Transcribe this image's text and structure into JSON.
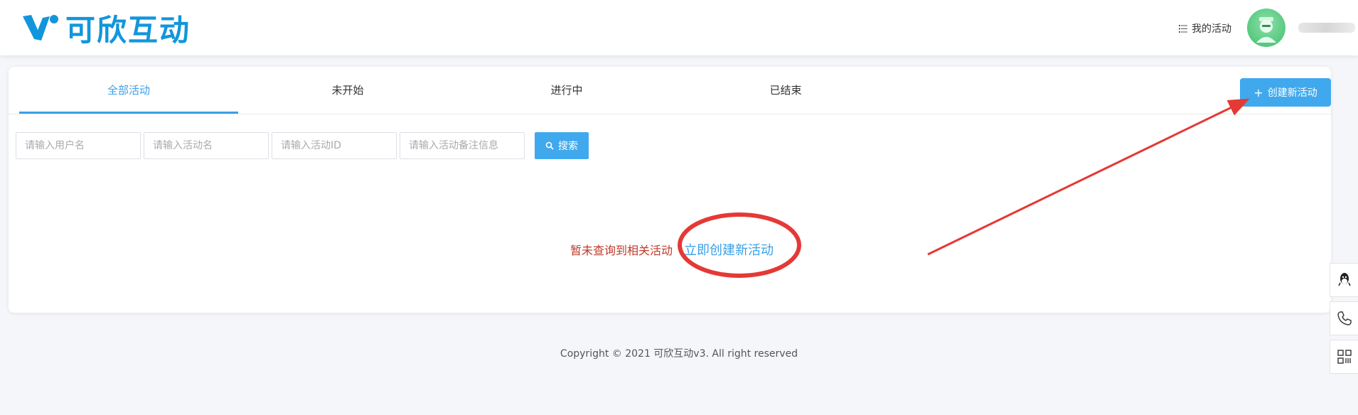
{
  "header": {
    "logo_text": "可欣互动",
    "my_activities": "我的活动",
    "username": ""
  },
  "tabs": [
    {
      "label": "全部活动",
      "active": true
    },
    {
      "label": "未开始",
      "active": false
    },
    {
      "label": "进行中",
      "active": false
    },
    {
      "label": "已结束",
      "active": false
    }
  ],
  "create_button": {
    "label": "创建新活动"
  },
  "search": {
    "username_placeholder": "请输入用户名",
    "activity_name_placeholder": "请输入活动名",
    "activity_id_placeholder": "请输入活动ID",
    "remark_placeholder": "请输入活动备注信息",
    "button_label": "搜索"
  },
  "empty": {
    "message": "暂未查询到相关活动",
    "link": "立即创建新活动"
  },
  "footer": {
    "copyright": "Copyright © 2021 可欣互动v3. All right reserved"
  },
  "colors": {
    "brand": "#1296db",
    "primary_button": "#40a9ee",
    "empty_text": "#c0392b",
    "annotation": "#e53935"
  },
  "side_tools": [
    "qq-icon",
    "phone-icon",
    "qrcode-icon"
  ]
}
